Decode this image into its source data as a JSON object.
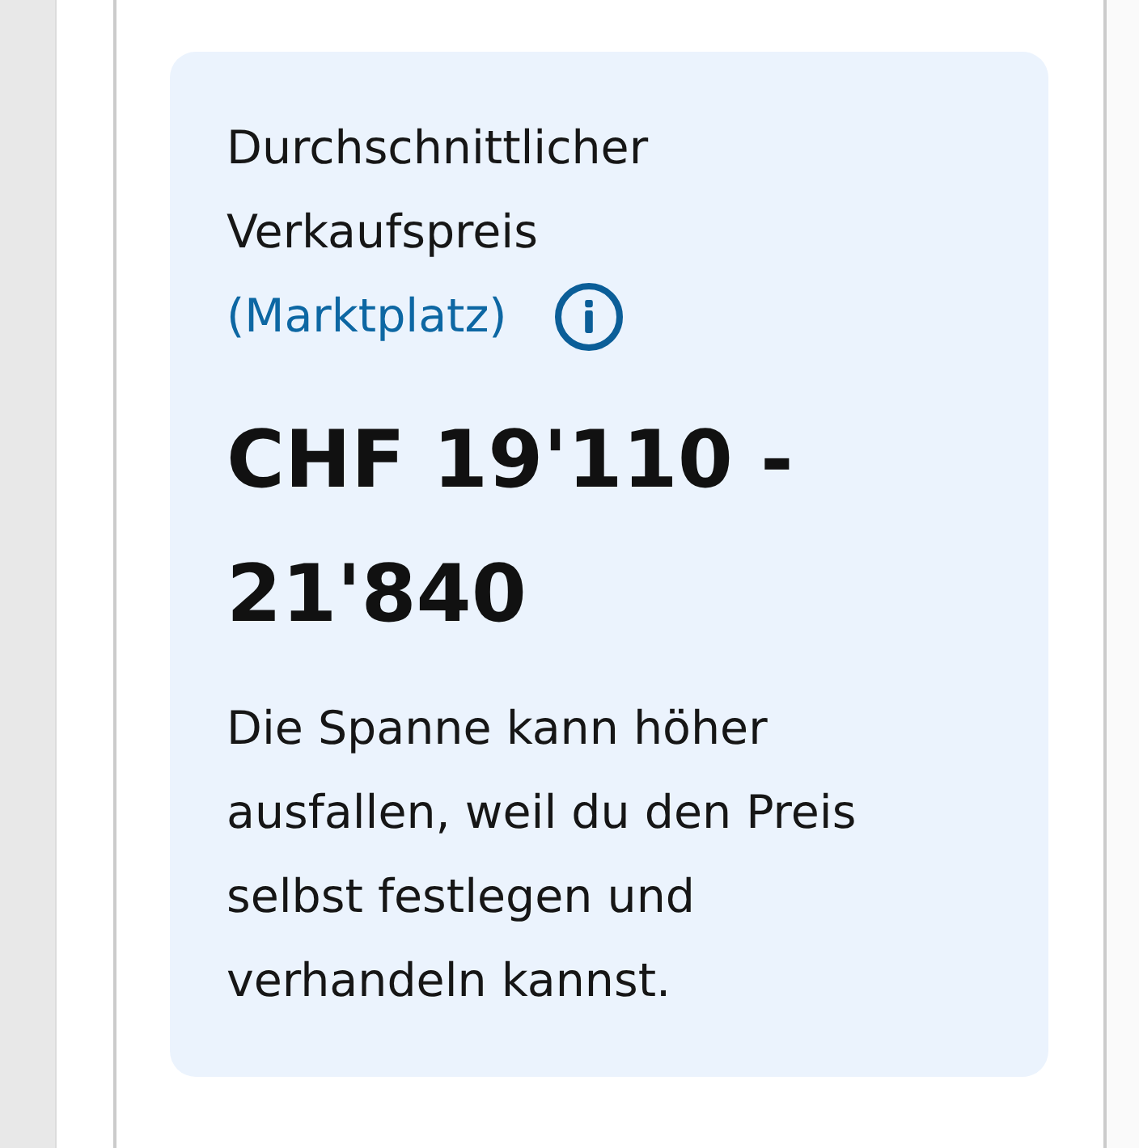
{
  "card": {
    "title": "Durchschnittlicher Verkaufspreis",
    "source": "(Marktplatz)",
    "price": "CHF 19'110 - 21'840",
    "note": "Die Spanne kann höher ausfallen, weil du den Preis selbst festlegen und verhandeln kannst."
  }
}
